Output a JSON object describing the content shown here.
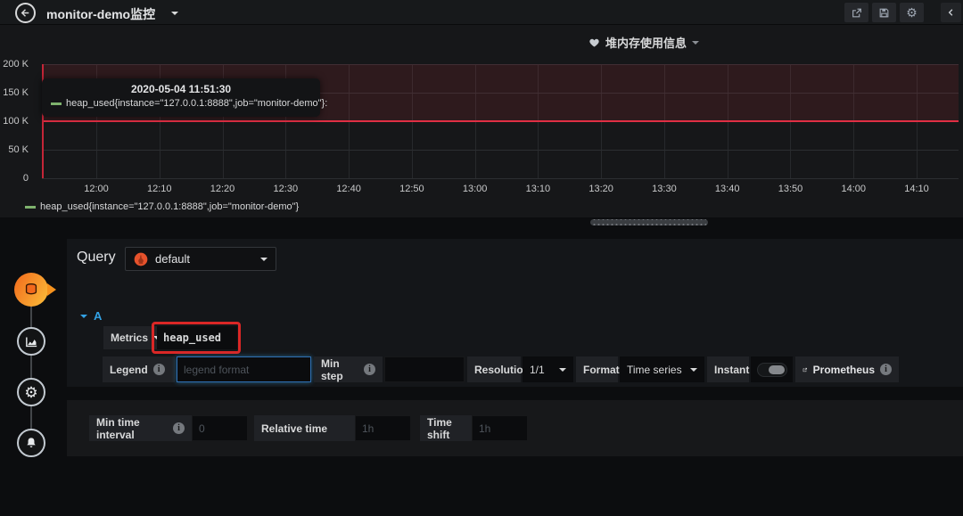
{
  "navbar": {
    "title": "monitor-demo监控"
  },
  "panel": {
    "title": "堆内存使用信息",
    "tooltip": {
      "time": "2020-05-04 11:51:30",
      "series": "heap_used{instance=\"127.0.0.1:8888\",job=\"monitor-demo\"}:"
    },
    "legend": "heap_used{instance=\"127.0.0.1:8888\",job=\"monitor-demo\"}",
    "y_ticks": [
      "200 K",
      "150 K",
      "100 K",
      "50 K",
      "0"
    ],
    "x_ticks": [
      "12:00",
      "12:10",
      "12:20",
      "12:30",
      "12:40",
      "12:50",
      "13:00",
      "13:10",
      "13:20",
      "13:30",
      "13:40",
      "13:50",
      "14:00",
      "14:10"
    ]
  },
  "chart_data": {
    "type": "line",
    "title": "堆内存使用信息",
    "x": [
      "12:00",
      "12:10",
      "12:20",
      "12:30",
      "12:40",
      "12:50",
      "13:00",
      "13:10",
      "13:20",
      "13:30",
      "13:40",
      "13:50",
      "14:00",
      "14:10"
    ],
    "series": [
      {
        "name": "heap_used{instance=\"127.0.0.1:8888\",job=\"monitor-demo\"}",
        "values": []
      }
    ],
    "ylabel": "",
    "xlabel": "",
    "ylim": [
      0,
      200000
    ],
    "threshold": 100000,
    "threshold_fill_above": true,
    "grid": true,
    "legend_position": "bottom"
  },
  "query": {
    "section_label": "Query",
    "datasource": "default",
    "ref_id": "A",
    "metrics_label": "Metrics",
    "metric_value": "heap_used",
    "legend_label": "Legend",
    "legend_placeholder": "legend format",
    "min_step_label": "Min step",
    "resolution_label": "Resolution",
    "resolution_value": "1/1",
    "format_label": "Format",
    "format_value": "Time series",
    "instant_label": "Instant",
    "datasource_link": "Prometheus"
  },
  "options": {
    "min_time_interval_label": "Min time interval",
    "min_time_interval_placeholder": "0",
    "relative_time_label": "Relative time",
    "relative_time_placeholder": "1h",
    "time_shift_label": "Time shift",
    "time_shift_placeholder": "1h"
  },
  "colors": {
    "accent_orange": "#e6522c",
    "threshold_red": "#e02f44",
    "legend_green": "#7eb26d",
    "ref_blue": "#33a2e5",
    "annotation_red": "#da2726",
    "focus_blue": "#2f6fb3"
  }
}
